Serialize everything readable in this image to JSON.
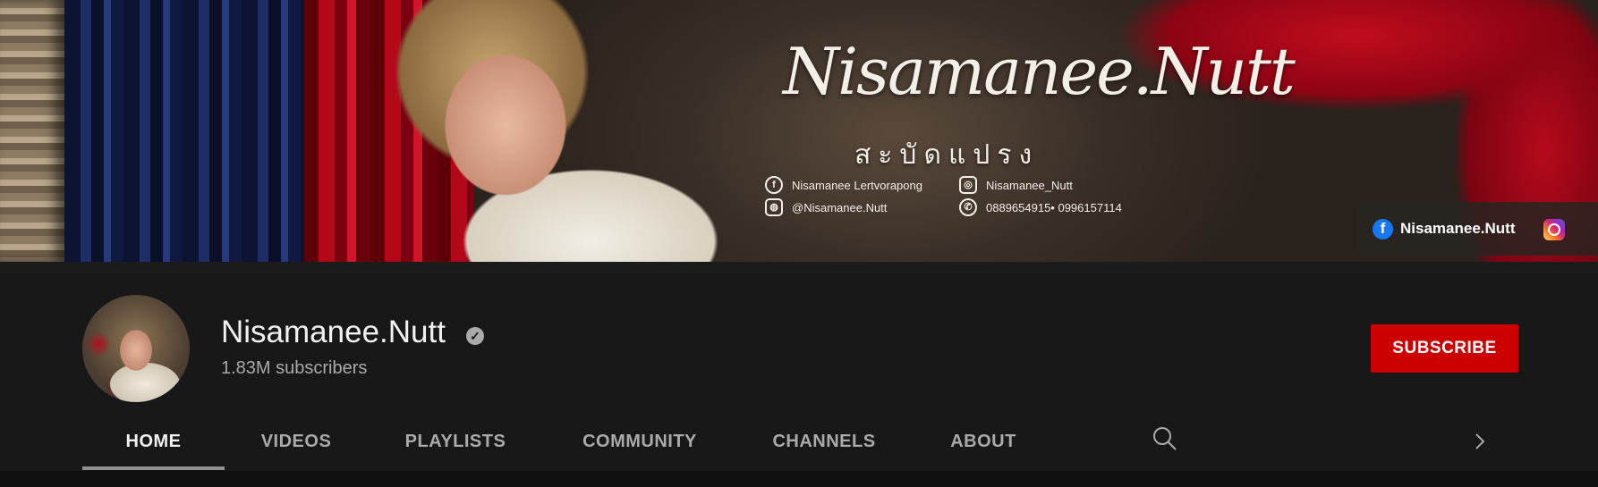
{
  "banner": {
    "logo_text": "Nisamanee.Nutt",
    "sub_text": "สะบัดแปรง",
    "contacts": {
      "facebook": "Nisamanee Lertvorapong",
      "instagram": "Nisamanee_Nutt",
      "line": "@Nisamanee.Nutt",
      "phone": "0889654915• 0996157114"
    },
    "social_links": {
      "facebook_label": "Nisamanee.Nutt"
    }
  },
  "channel": {
    "name": "Nisamanee.Nutt",
    "subscribers": "1.83M subscribers",
    "verified": true
  },
  "subscribe_label": "SUBSCRIBE",
  "tabs": [
    {
      "label": "HOME",
      "active": true
    },
    {
      "label": "VIDEOS",
      "active": false
    },
    {
      "label": "PLAYLISTS",
      "active": false
    },
    {
      "label": "COMMUNITY",
      "active": false
    },
    {
      "label": "CHANNELS",
      "active": false
    },
    {
      "label": "ABOUT",
      "active": false
    }
  ],
  "icons": {
    "search": "search-icon",
    "next": "chevron-right-icon",
    "verified": "verified-badge-icon"
  },
  "colors": {
    "subscribe_bg": "#cc0000",
    "background": "#181818",
    "facebook": "#1877f2"
  }
}
